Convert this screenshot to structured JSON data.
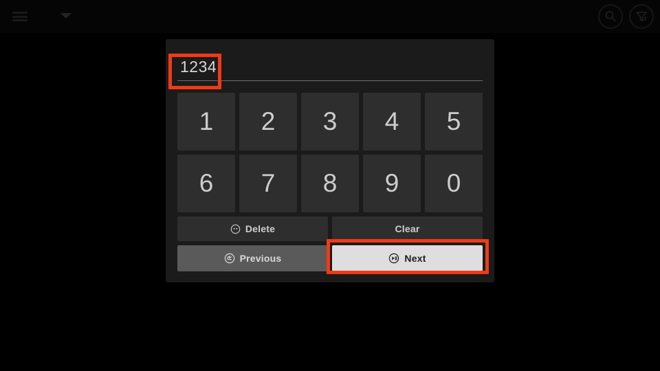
{
  "topbar": {
    "menu_icon": "hamburger-menu-icon",
    "dropdown_icon": "chevron-down-icon",
    "search_icon": "search-icon",
    "filter_icon": "filter-icon"
  },
  "dialog": {
    "input": {
      "value": "1234",
      "placeholder": ""
    },
    "keys": [
      {
        "label": "1"
      },
      {
        "label": "2"
      },
      {
        "label": "3"
      },
      {
        "label": "4"
      },
      {
        "label": "5"
      },
      {
        "label": "6"
      },
      {
        "label": "7"
      },
      {
        "label": "8"
      },
      {
        "label": "9"
      },
      {
        "label": "0"
      }
    ],
    "actions": {
      "delete_label": "Delete",
      "delete_icon": "circle-dots-icon",
      "clear_label": "Clear",
      "previous_label": "Previous",
      "previous_icon": "circle-back-arrow-icon",
      "next_label": "Next",
      "next_icon": "circle-play-pause-icon"
    }
  },
  "highlights": {
    "color": "#f03a16",
    "pin_field": "pin-input-highlight",
    "next_button": "next-button-highlight"
  }
}
